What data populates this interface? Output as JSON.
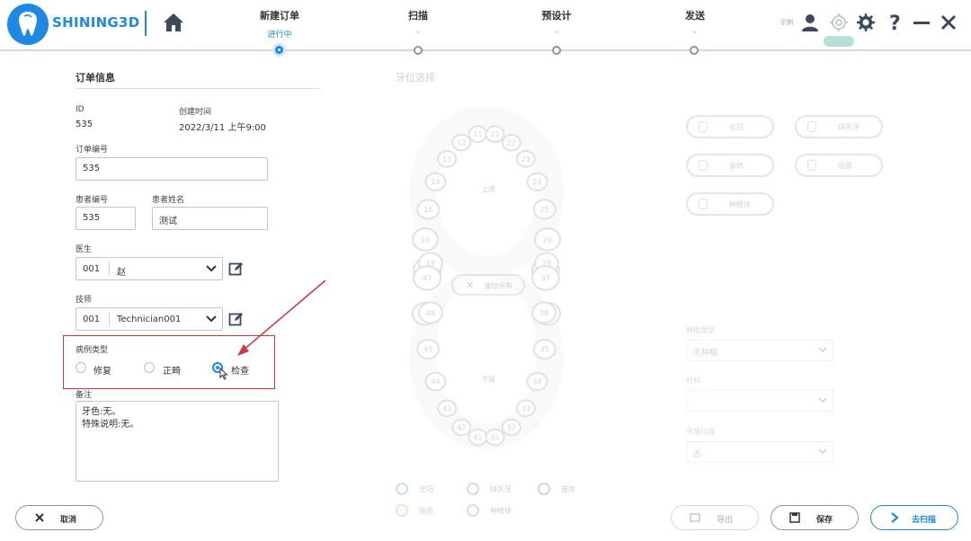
{
  "header": {
    "brand": "SHINING3D",
    "steps": [
      {
        "name": "新建订单",
        "status": "进行中",
        "active": true
      },
      {
        "name": "扫描",
        "status": "-",
        "active": false
      },
      {
        "name": "预设计",
        "status": "-",
        "active": false
      },
      {
        "name": "发送",
        "status": "-",
        "active": false
      }
    ],
    "user_label": "示例"
  },
  "order": {
    "section_title": "订单信息",
    "id_label": "ID",
    "id_value": "535",
    "created_label": "创建时间",
    "created_value": "2022/3/11 上午9:00",
    "order_no_label": "订单编号",
    "order_no_value": "535",
    "patient_no_label": "患者编号",
    "patient_no_value": "535",
    "patient_name_label": "患者姓名",
    "patient_name_value": "测试",
    "doctor_label": "医生",
    "doctor_code": "001",
    "doctor_name": "赵",
    "tech_label": "技师",
    "tech_code": "001",
    "tech_name": "Technician001",
    "case_type_label": "病例类型",
    "case_types": [
      "修复",
      "正畸",
      "检查"
    ],
    "case_type_selected": "检查",
    "notes_label": "备注",
    "notes_line1": "牙色:无。",
    "notes_line2": "特殊说明:无。"
  },
  "tooth_panel": {
    "title": "牙位选择",
    "upper_label": "上颌",
    "lower_label": "下颌",
    "clear_label": "清除所有",
    "upper_teeth": [
      "17",
      "16",
      "15",
      "14",
      "13",
      "12",
      "11",
      "21",
      "22",
      "23",
      "24",
      "25",
      "26",
      "27"
    ],
    "upper_extra": [
      "18",
      "28"
    ],
    "lower_teeth": [
      "47",
      "46",
      "45",
      "44",
      "43",
      "42",
      "41",
      "31",
      "32",
      "33",
      "34",
      "35",
      "36",
      "37"
    ],
    "lower_extra": [
      "48",
      "38"
    ]
  },
  "tools": [
    {
      "label": "全冠"
    },
    {
      "label": "缺失牙"
    },
    {
      "label": "嵌体"
    },
    {
      "label": "贴面"
    },
    {
      "label": "种植体"
    }
  ],
  "right_fields": [
    {
      "label": "种植类型",
      "value": "无种植"
    },
    {
      "label": "材料",
      "value": ""
    },
    {
      "label": "牙龈扫描",
      "value": "否"
    }
  ],
  "legend": [
    {
      "label": "全冠",
      "color": "#4a90a4"
    },
    {
      "label": "缺失牙",
      "color": "#6a7fa8"
    },
    {
      "label": "嵌体",
      "color": "#7060a8"
    },
    {
      "label": "贴面",
      "color": "#c8a84a"
    },
    {
      "label": "种植体",
      "color": "#c86a6a"
    }
  ],
  "footer": {
    "cancel_label": "取消",
    "import_label": "导出",
    "save_label": "保存",
    "scan_label": "去扫描"
  },
  "colors": {
    "accent": "#1e88e5",
    "highlight": "#d0363a"
  }
}
